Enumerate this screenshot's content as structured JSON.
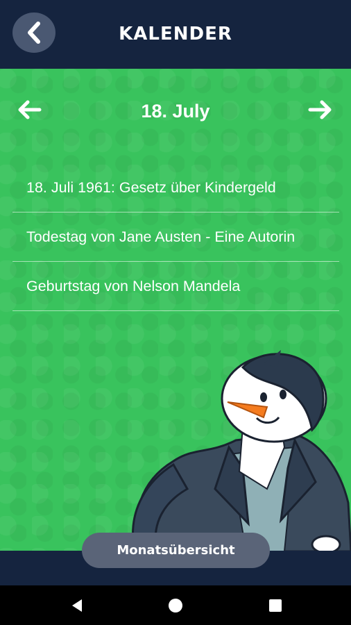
{
  "header": {
    "title": "KALENDER"
  },
  "calendar": {
    "date_label": "18. July",
    "events": [
      {
        "label": "18. Juli 1961: Gesetz über Kindergeld"
      },
      {
        "label": "Todestag von Jane Austen - Eine Autorin"
      },
      {
        "label": "Geburtstag von Nelson Mandela"
      }
    ]
  },
  "footer": {
    "month_overview_label": "Monatsübersicht"
  },
  "colors": {
    "header_bg": "#15243f",
    "content_bg": "#39c35d",
    "button_bg": "#5a6478"
  },
  "icons": {
    "back": "chevron-left-icon",
    "prev": "arrow-left-icon",
    "next": "arrow-right-icon",
    "mascot": "penguin-mascot"
  }
}
